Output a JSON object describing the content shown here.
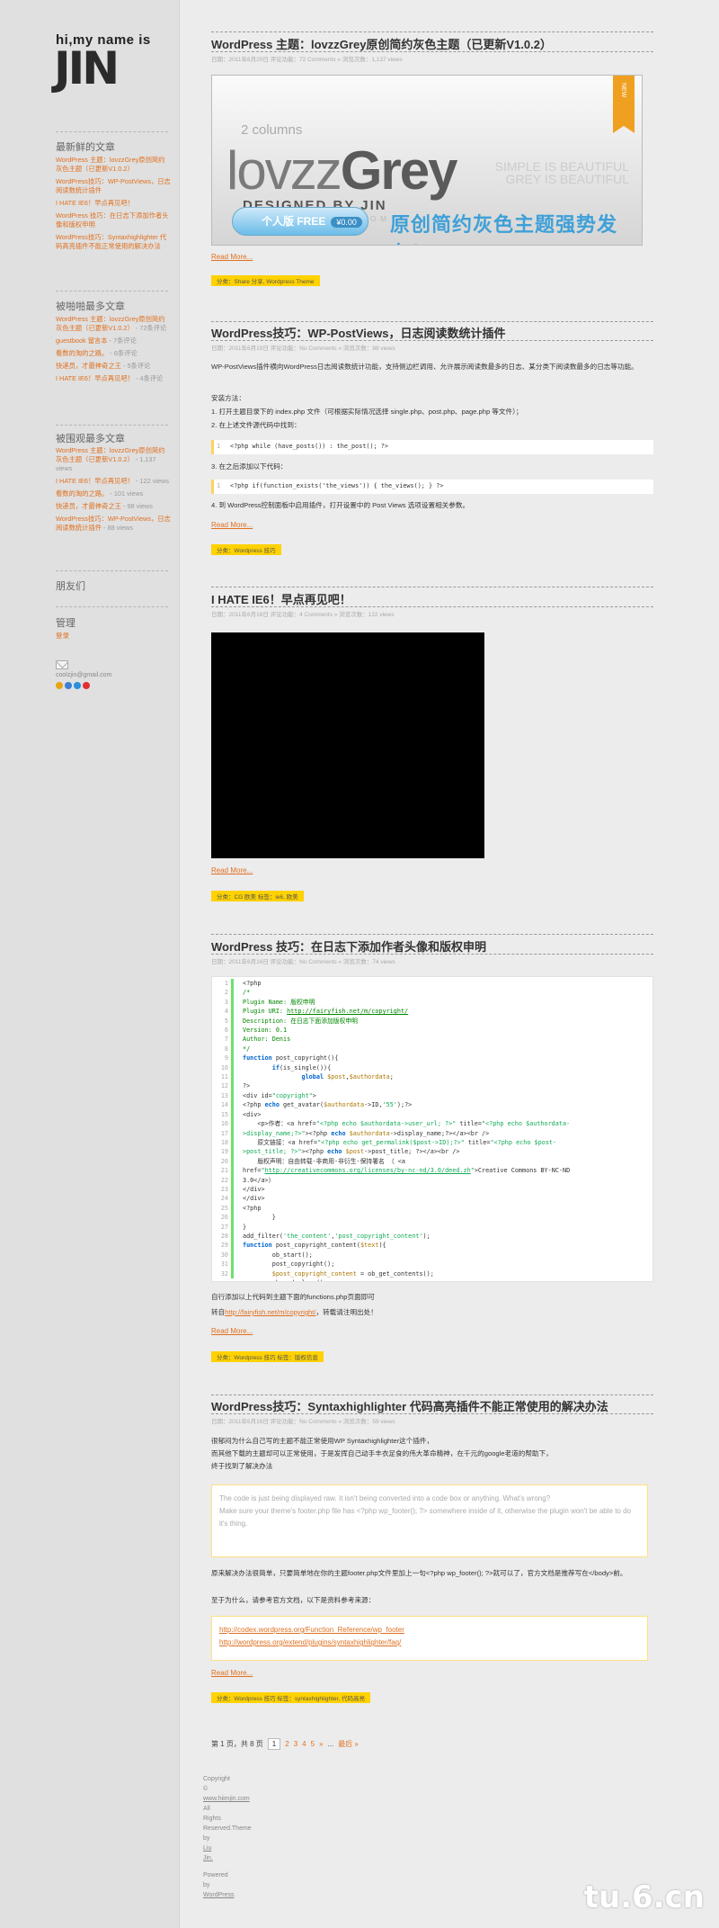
{
  "sidebar": {
    "greeting": "hi,my name is",
    "name": "JIN",
    "recent": {
      "title": "最新鲜的文章",
      "items": [
        "WordPress 主题：lovzzGrey原创简约灰色主题（已更新V1.0.2）",
        "WordPress技巧：WP-PostViews，日志阅读数统计插件",
        "I HATE IE6！早点再见吧！",
        "WordPress 技巧：在日志下添加作者头像和版权申明",
        "WordPress技巧：Syntaxhighlighter 代码高亮插件不能正常使用的解决办法"
      ]
    },
    "most_commented": {
      "title": "被啪啪最多文章",
      "items": [
        {
          "label": "WordPress 主题：lovzzGrey原创简约灰色主题（已更新V1.0.2）",
          "count": "- 72条评论"
        },
        {
          "label": "guestbook 留言本",
          "count": "- 7条评论"
        },
        {
          "label": "看数的淘的之路。",
          "count": "- 6条评论"
        },
        {
          "label": "快递员，才最神奇之王",
          "count": "- 5条评论"
        },
        {
          "label": "I HATE IE6！早点再见吧！",
          "count": "- 4条评论"
        }
      ]
    },
    "most_viewed": {
      "title": "被围观最多文章",
      "items": [
        {
          "label": "WordPress 主题：lovzzGrey原创简约灰色主题（已更新V1.0.2）",
          "count": "- 1,137 views"
        },
        {
          "label": "I HATE IE6！早点再见吧！",
          "count": "- 122 views"
        },
        {
          "label": "看数的淘的之路。",
          "count": "- 101 views"
        },
        {
          "label": "快递员，才最神奇之王",
          "count": "- 98 views"
        },
        {
          "label": "WordPress技巧：WP-PostViews，日志阅读数统计插件",
          "count": "- 88 views"
        }
      ]
    },
    "friends": {
      "title": "朋友们"
    },
    "admin": {
      "title": "管理",
      "login": "登录"
    },
    "email": "coolzjin@gmail.com"
  },
  "posts": [
    {
      "title": "WordPress 主题：lovzzGrey原创简约灰色主题（已更新V1.0.2）",
      "meta": "日期：2011年6月20日    评论功能：72 Comments »    浏览次数：1,137 views",
      "read_more": "Read More...",
      "category": "分类：Share 分享, Wordpress Theme"
    },
    {
      "title": "WordPress技巧：WP-PostViews，日志阅读数统计插件",
      "meta": "日期：2011年6月19日    评论功能：No Comments »    浏览次数：88 views",
      "read_more": "Read More...",
      "category": "分类：Wordpress 技巧"
    },
    {
      "title": "I HATE IE6！早点再见吧！",
      "meta": "日期：2011年6月16日    评论功能：4 Comments »    浏览次数：122 views",
      "read_more": "Read More...",
      "category": "分类：CG 欧美    标签：ie6, 欧美"
    },
    {
      "title": "WordPress 技巧：在日志下添加作者头像和版权申明",
      "meta": "日期：2011年6月16日    评论功能：No Comments »    浏览次数：74 views",
      "read_more": "Read More...",
      "category": "分类：Wordpress 技巧    标签：版权信息"
    },
    {
      "title": "WordPress技巧：Syntaxhighlighter 代码高亮插件不能正常使用的解决办法",
      "meta": "日期：2011年6月16日    评论功能：No Comments »    浏览次数：59 views",
      "read_more": "Read More...",
      "category": "分类：Wordpress 技巧    标签：syntaxhighlighter, 代码高亮"
    }
  ],
  "banner": {
    "two_col": "2 columns",
    "name_a": "lovzz",
    "name_b": "Grey",
    "by": "DESIGNED BY JIN",
    "url": "WWW.COOLZJIN.COM",
    "simple1": "SIMPLE IS BEAUTIFUL",
    "simple2": "GREY IS BEAUTIFUL",
    "btn": "个人版  FREE",
    "price": "¥0.00",
    "slogan": "原创简约灰色主题强势发布！",
    "ribbon": "NEW"
  },
  "post2": {
    "p1": "WP-PostViews插件横向WordPress日志阅读数统计功能，支持侧边栏调用、允许展示阅读数最多的日志、某分类下阅读数最多的日志等功能。",
    "p2": "安装方法：",
    "p3": "1. 打开主题目录下的 index.php 文件（可根据实际情况选择 single.php、post.php、page.php 等文件）；",
    "p4": "2. 在上述文件源代码中找到：",
    "code1": "<?php while (have_posts()) : the_post(); ?>",
    "p5": "3. 在之后添加以下代码：",
    "code2": "<?php if(function_exists('the_views')) { the_views(); } ?>",
    "p6": "4. 到 WordPress控制面板中启用插件，打开设置中的 Post Views 选项设置相关参数。"
  },
  "post4": {
    "after1": "自行添加以上代码到主题下面的functions.php页面即可",
    "after2a": "转自",
    "after2link": "http://fairyfish.net/m/copyright/",
    "after2b": "，转载请注明出处！"
  },
  "post5": {
    "p1": "很郁闷为什么自己写的主题不能正常使用WP Syntaxhighlighter这个插件，",
    "p2": "而其他下载的主题却可以正常使用，于是发挥自己动手丰衣足食的伟大革命精神，在千元的google老道的帮助下，",
    "p3": "终于找到了解决办法",
    "quote1": "The code is just being displayed raw. It isn't being converted into a code box or anything. What's wrong?",
    "quote2": "Make sure your theme's footer.php file has <?php wp_footer(); ?> somewhere inside of it, otherwise the plugin won't be able to do it's thing.",
    "p4": "原来解决办法很简单，只要简单地在你的主题footer.php文件里加上一句<?php wp_footer(); ?>就可以了，官方文档是推荐写在</body>前。",
    "p5": "至于为什么，请参考官方文档，以下是资料参考来源：",
    "link1": "http://codex.wordpress.org/Function_Reference/wp_footer",
    "link2": "http://wordpress.org/extend/plugins/syntaxhighlighter/faq/"
  },
  "pager": {
    "label": "第 1 页，共 8 页",
    "current": "1",
    "pages": [
      "2",
      "3",
      "4",
      "5"
    ],
    "next": "»",
    "dots": "...",
    "last": "最后 »"
  },
  "footer": {
    "l1": "Copyright",
    "l2": "©",
    "l3": "www.hiimjin.com",
    "l4": "All",
    "l5": "Rights",
    "l6": "Reserved.Theme",
    "l7": "by",
    "l8": "Liu",
    "l9": "Jin.",
    "l10": "Powered",
    "l11": "by",
    "l12": "WordPress"
  },
  "watermark": "tu.6.cn"
}
